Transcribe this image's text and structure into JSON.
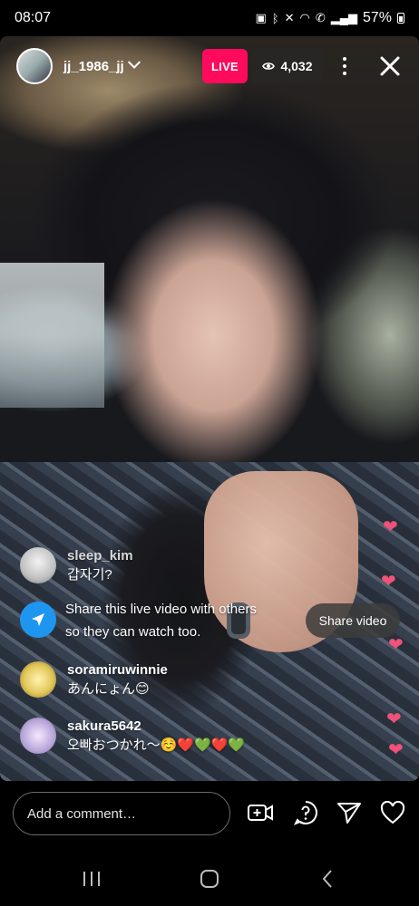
{
  "status_bar": {
    "time": "08:07",
    "icons": [
      "lock-icon",
      "bluetooth-icon",
      "mute-icon",
      "wifi-icon",
      "call-icon",
      "signal-icon"
    ],
    "battery": "57%"
  },
  "header": {
    "host_name": "jj_1986_jj",
    "live_label": "LIVE",
    "viewer_count": "4,032"
  },
  "comments": [
    {
      "user": "sleep_kim",
      "text": "갑자기?",
      "avatar_color": "#d8d8d8"
    },
    {
      "user": "soramiruwinnie",
      "text": "あんにょん😊",
      "avatar_color": "#e2c85a"
    },
    {
      "user": "sakura5642",
      "text": "오빠おつかれ〜☺️❤️💚❤️💚",
      "avatar_color": "#b8a6d8"
    }
  ],
  "share_notice": {
    "line1": "Share this live video with others",
    "line2": "so they can watch too.",
    "button": "Share video"
  },
  "composer": {
    "placeholder": "Add a comment…"
  },
  "colors": {
    "live": "#ff0a5c",
    "share_icon_bg": "#1e96f0",
    "heart": "#f0527a"
  }
}
